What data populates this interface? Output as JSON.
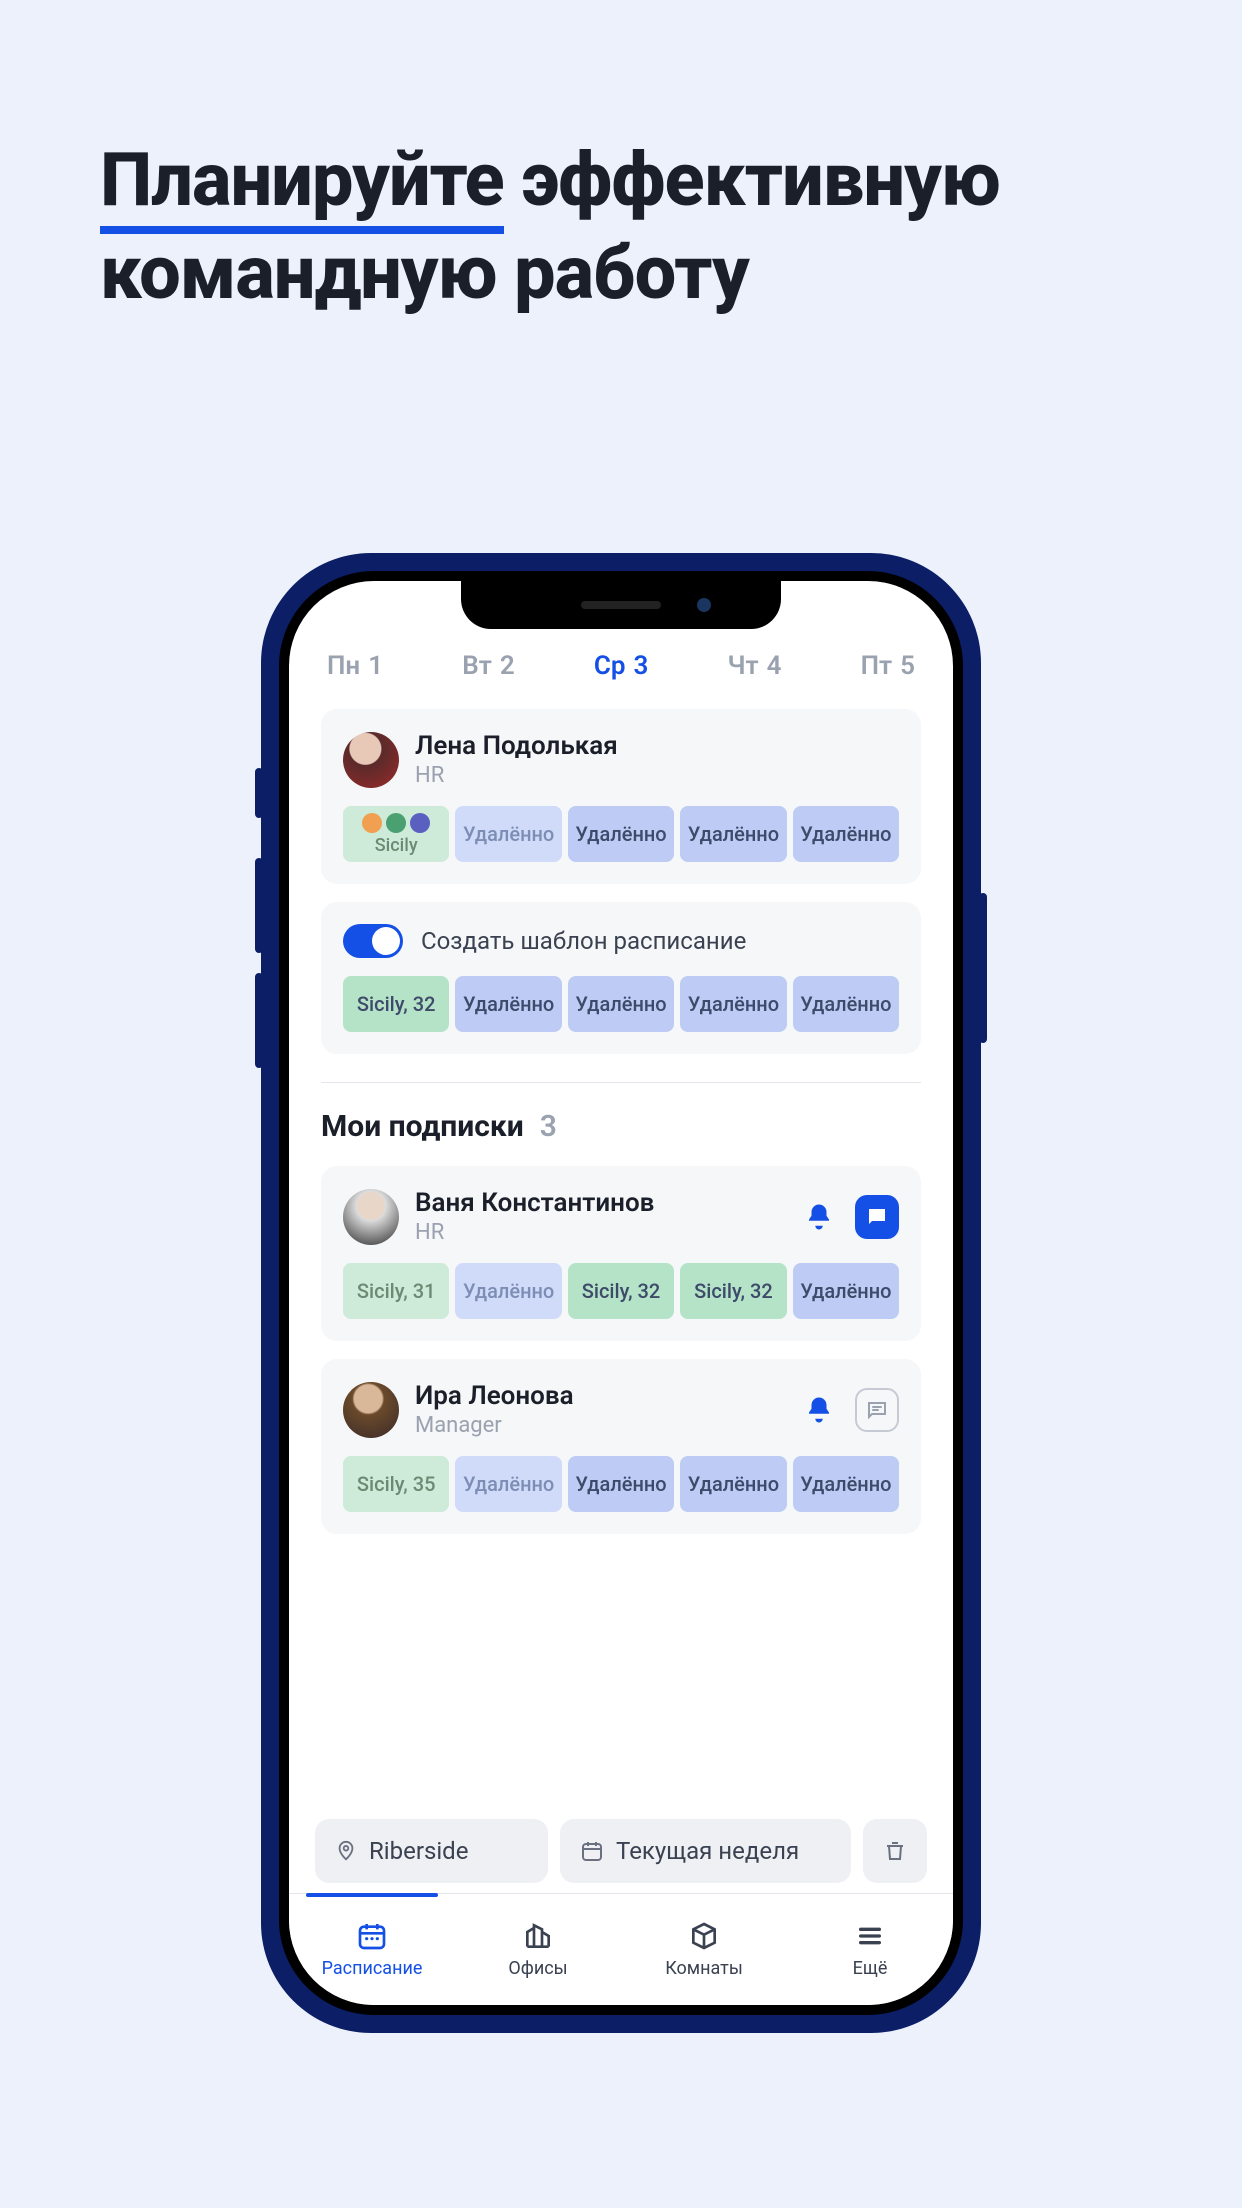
{
  "headline_word1": "Планируйте",
  "headline_rest": "эффективную командную работу",
  "days": [
    {
      "dow": "Пн",
      "num": "1",
      "active": false
    },
    {
      "dow": "Вт",
      "num": "2",
      "active": false
    },
    {
      "dow": "Ср",
      "num": "3",
      "active": true
    },
    {
      "dow": "Чт",
      "num": "4",
      "active": false
    },
    {
      "dow": "Пт",
      "num": "5",
      "active": false
    }
  ],
  "me": {
    "name": "Лена Подолькая",
    "role": "HR",
    "schedule": [
      "Sicily",
      "Удалённо",
      "Удалённо",
      "Удалённо",
      "Удалённо"
    ]
  },
  "template": {
    "enabled": true,
    "label": "Создать шаблон расписание",
    "schedule": [
      "Sicily, 32",
      "Удалённо",
      "Удалённо",
      "Удалённо",
      "Удалённо"
    ]
  },
  "subscriptions": {
    "title": "Мои подписки",
    "count": "3",
    "people": [
      {
        "name": "Ваня Константинов",
        "role": "HR",
        "notify": true,
        "chat_filled": true,
        "schedule": [
          {
            "label": "Sicily, 31",
            "type": "office",
            "dim": true
          },
          {
            "label": "Удалённо",
            "type": "remote",
            "dim": true
          },
          {
            "label": "Sicily, 32",
            "type": "office",
            "dim": false
          },
          {
            "label": "Sicily, 32",
            "type": "office",
            "dim": false
          },
          {
            "label": "Удалённо",
            "type": "remote",
            "dim": false
          }
        ]
      },
      {
        "name": "Ира Леонова",
        "role": "Manager",
        "notify": true,
        "chat_filled": false,
        "schedule": [
          {
            "label": "Sicily, 35",
            "type": "office",
            "dim": true
          },
          {
            "label": "Удалённо",
            "type": "remote",
            "dim": true
          },
          {
            "label": "Удалённо",
            "type": "remote",
            "dim": false
          },
          {
            "label": "Удалённо",
            "type": "remote",
            "dim": false
          },
          {
            "label": "Удалённо",
            "type": "remote",
            "dim": false
          }
        ]
      }
    ]
  },
  "filters": {
    "location": "Riberside",
    "week": "Текущая неделя"
  },
  "tabs": [
    {
      "label": "Расписание",
      "active": true
    },
    {
      "label": "Офисы",
      "active": false
    },
    {
      "label": "Комнаты",
      "active": false
    },
    {
      "label": "Ещё",
      "active": false
    }
  ]
}
